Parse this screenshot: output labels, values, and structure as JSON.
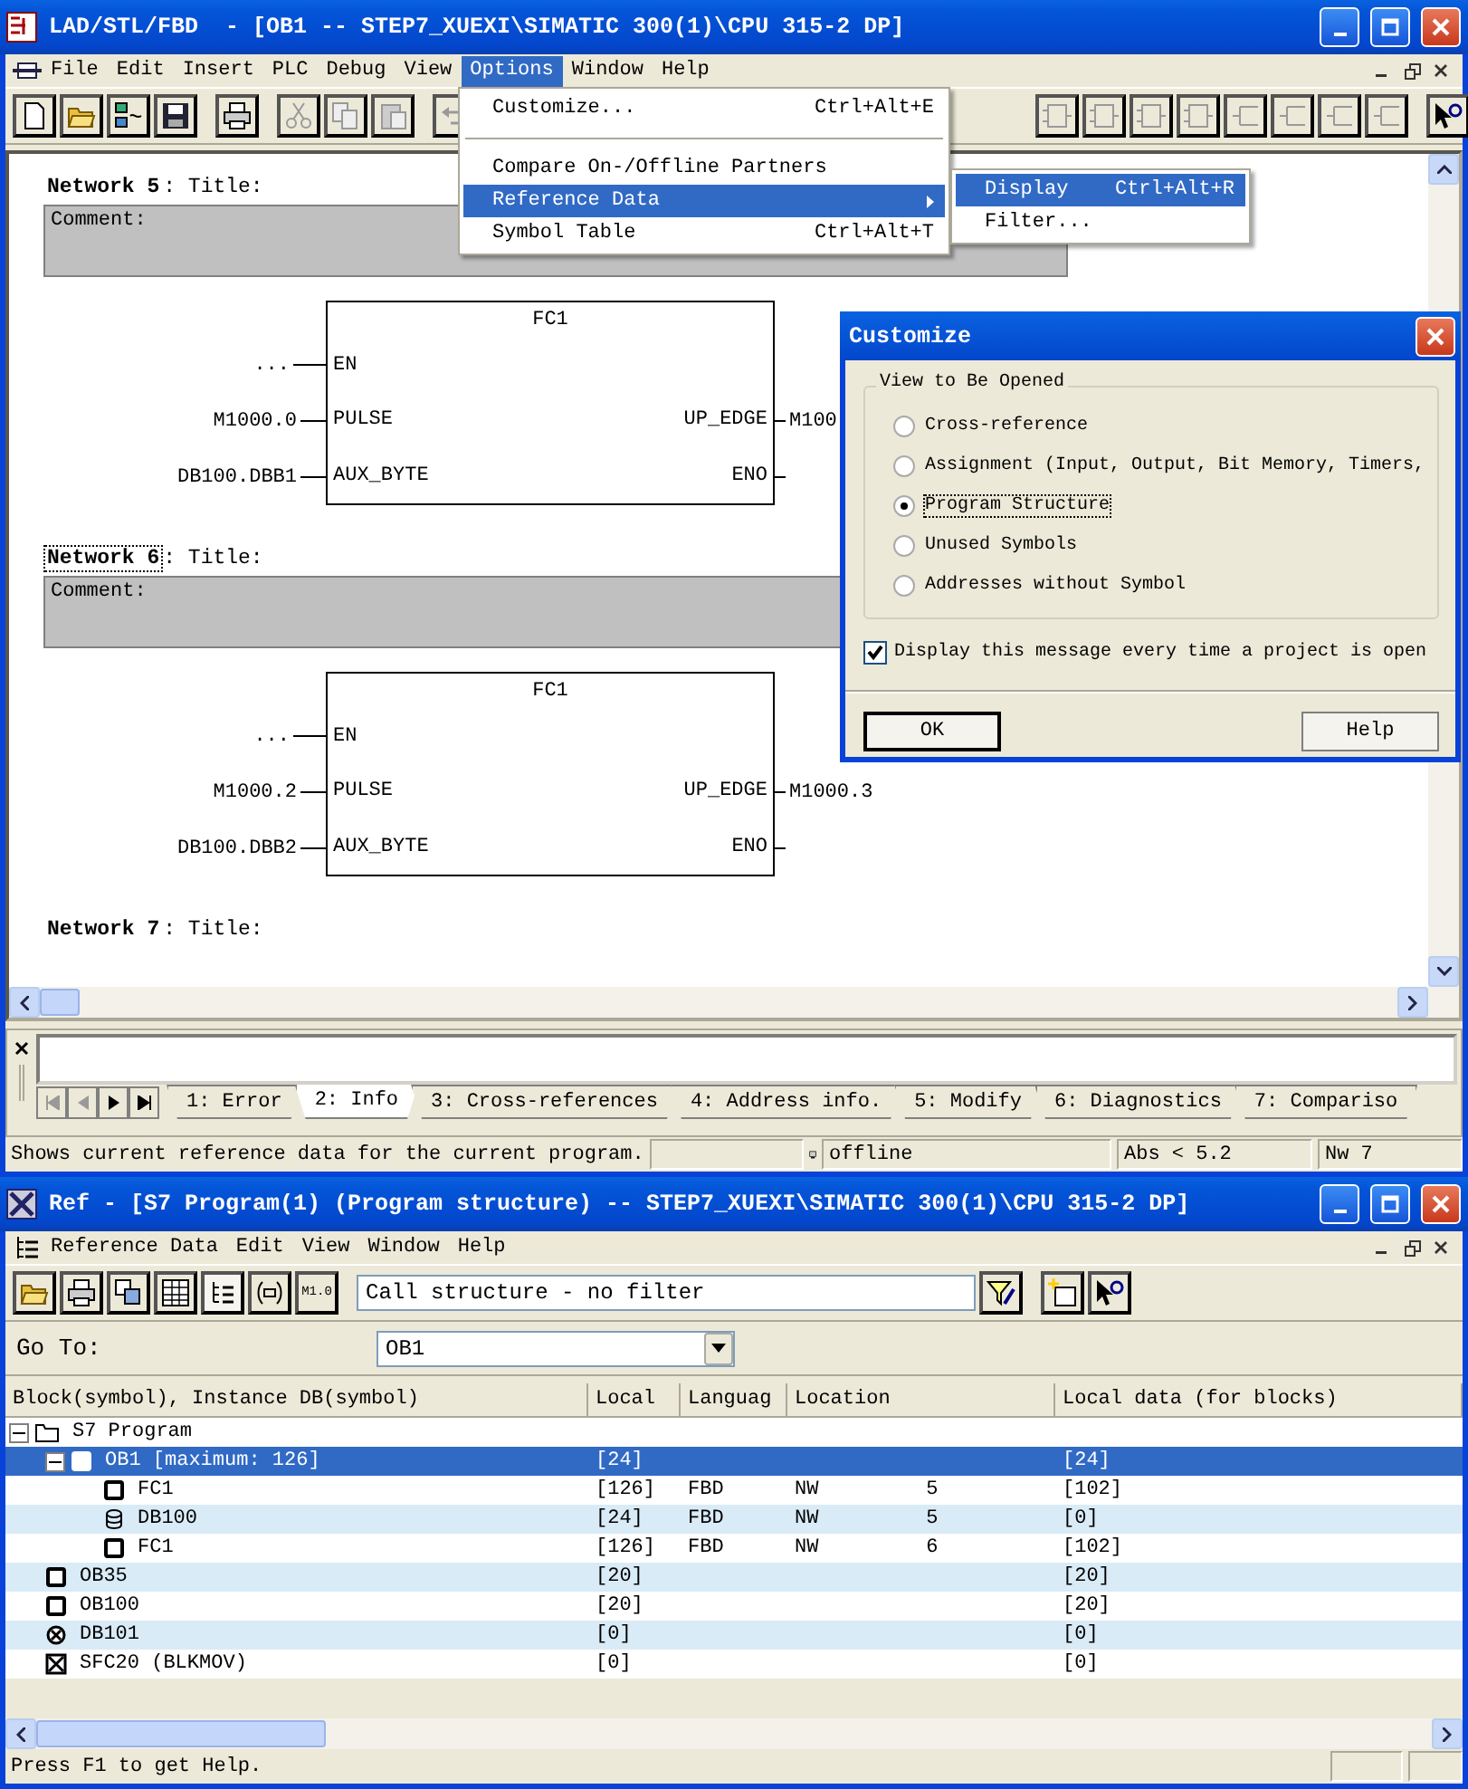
{
  "editor_window": {
    "title": "LAD/STL/FBD  - [OB1 -- STEP7_XUEXI\\SIMATIC 300(1)\\CPU 315-2 DP]",
    "menu": [
      {
        "label": "File",
        "selected": false
      },
      {
        "label": "Edit",
        "selected": false
      },
      {
        "label": "Insert",
        "selected": false
      },
      {
        "label": "PLC",
        "selected": false
      },
      {
        "label": "Debug",
        "selected": false
      },
      {
        "label": "View",
        "selected": false
      },
      {
        "label": "Options",
        "selected": true
      },
      {
        "label": "Window",
        "selected": false
      },
      {
        "label": "Help",
        "selected": false
      }
    ],
    "networks": [
      {
        "label": "Network 5",
        "title": ": Title:",
        "focused": false,
        "comment": "Comment:",
        "block": {
          "name": "FC1",
          "inputs": [
            {
              "pin": "EN",
              "signal": "..."
            },
            {
              "pin": "PULSE",
              "signal": "M1000.0"
            },
            {
              "pin": "AUX_BYTE",
              "signal": "DB100.DBB1"
            }
          ],
          "outputs": [
            {
              "pin": "UP_EDGE",
              "signal": "M100"
            },
            {
              "pin": "ENO"
            }
          ]
        }
      },
      {
        "label": "Network 6",
        "title": ": Title:",
        "focused": true,
        "comment": "Comment:",
        "block": {
          "name": "FC1",
          "inputs": [
            {
              "pin": "EN",
              "signal": "..."
            },
            {
              "pin": "PULSE",
              "signal": "M1000.2"
            },
            {
              "pin": "AUX_BYTE",
              "signal": "DB100.DBB2"
            }
          ],
          "outputs": [
            {
              "pin": "UP_EDGE",
              "signal": "M1000.3"
            },
            {
              "pin": "ENO"
            }
          ]
        }
      },
      {
        "label": "Network 7",
        "title": ": Title:",
        "focused": false
      }
    ],
    "options_menu": [
      {
        "kind": "item",
        "label": "Customize...",
        "shortcut": "Ctrl+Alt+E",
        "selected": false
      },
      {
        "kind": "separator"
      },
      {
        "kind": "item",
        "label": "Compare On-/Offline Partners",
        "selected": false
      },
      {
        "kind": "submenu",
        "label": "Reference Data",
        "selected": true
      },
      {
        "kind": "item",
        "label": "Symbol Table",
        "shortcut": "Ctrl+Alt+T",
        "selected": false
      }
    ],
    "submenu": [
      {
        "label": "Display",
        "shortcut": "Ctrl+Alt+R",
        "selected": true
      },
      {
        "label": "Filter...",
        "selected": false
      }
    ],
    "output_tabs": [
      {
        "label": "1: Error",
        "selected": false
      },
      {
        "label": "2: Info",
        "selected": true
      },
      {
        "label": "3: Cross-references",
        "selected": false
      },
      {
        "label": "4: Address info.",
        "selected": false
      },
      {
        "label": "5: Modify",
        "selected": false
      },
      {
        "label": "6: Diagnostics",
        "selected": false
      },
      {
        "label": "7: Compariso",
        "selected": false
      }
    ],
    "status_bar": {
      "message": "Shows current reference data for the current program.",
      "connection": "offline",
      "position": "Abs < 5.2",
      "network": "Nw 7"
    }
  },
  "customize_dialog": {
    "title": "Customize",
    "group": "View to Be Opened",
    "options": [
      {
        "label": "Cross-reference",
        "selected": false,
        "focused": false
      },
      {
        "label": "Assignment (Input, Output, Bit Memory, Timers,",
        "selected": false,
        "focused": false
      },
      {
        "label": "Program Structure",
        "selected": true,
        "focused": true
      },
      {
        "label": "Unused Symbols",
        "selected": false,
        "focused": false
      },
      {
        "label": "Addresses without Symbol",
        "selected": false,
        "focused": false
      }
    ],
    "checkbox": {
      "label": "Display this message every time a project is open",
      "checked": true
    },
    "buttons": [
      {
        "label": "OK",
        "default": true
      },
      {
        "label": "Help",
        "default": false
      }
    ]
  },
  "ref_window": {
    "title": "Ref - [S7 Program(1) (Program structure) -- STEP7_XUEXI\\SIMATIC 300(1)\\CPU 315-2 DP]",
    "menu": [
      {
        "label": "Reference Data"
      },
      {
        "label": "Edit"
      },
      {
        "label": "View"
      },
      {
        "label": "Window"
      },
      {
        "label": "Help"
      }
    ],
    "toolbar": [
      {
        "kind": "open",
        "pressed": false
      },
      {
        "kind": "print",
        "pressed": false
      },
      {
        "kind": "windows",
        "pressed": false
      },
      {
        "kind": "table",
        "pressed": false
      },
      {
        "kind": "tree",
        "pressed": true
      },
      {
        "kind": "brackets",
        "pressed": false
      },
      {
        "kind": "address",
        "label": "M1.0",
        "pressed": false
      }
    ],
    "filter": "Call structure - no filter",
    "goto_label": "Go To:",
    "goto_value": "OB1",
    "columns": [
      "Block(symbol), Instance DB(symbol)",
      "Local",
      "Languag",
      "Location",
      "Local data (for blocks)"
    ],
    "rows": [
      {
        "kind": "folder",
        "name": "S7 Program",
        "expanded": true,
        "selected": false,
        "children": [
          {
            "kind": "block",
            "name": "OB1 [maximum: 126]",
            "local": "[24]",
            "local_data": "[24]",
            "expanded": true,
            "selected": true,
            "children": [
              {
                "kind": "block",
                "name": "FC1",
                "local": "[126]",
                "language": "FBD",
                "location": "NW         5",
                "local_data": "[102]",
                "selected": false
              },
              {
                "kind": "data-block",
                "name": "DB100",
                "local": "[24]",
                "language": "FBD",
                "location": "NW         5",
                "local_data": "[0]",
                "selected": false
              },
              {
                "kind": "block",
                "name": "FC1",
                "local": "[126]",
                "language": "FBD",
                "location": "NW         6",
                "local_data": "[102]",
                "selected": false
              }
            ]
          },
          {
            "kind": "block",
            "name": "OB35",
            "local": "[20]",
            "local_data": "[20]",
            "selected": false
          },
          {
            "kind": "block",
            "name": "OB100",
            "local": "[20]",
            "local_data": "[20]",
            "selected": false
          },
          {
            "kind": "missing-data-block",
            "name": "DB101",
            "local": "[0]",
            "local_data": "[0]",
            "selected": false
          },
          {
            "kind": "system-function",
            "name": "SFC20 (BLKMOV)",
            "local": "[0]",
            "local_data": "[0]",
            "selected": false
          }
        ]
      }
    ],
    "status_bar": {
      "message": "Press F1 to get Help."
    }
  }
}
